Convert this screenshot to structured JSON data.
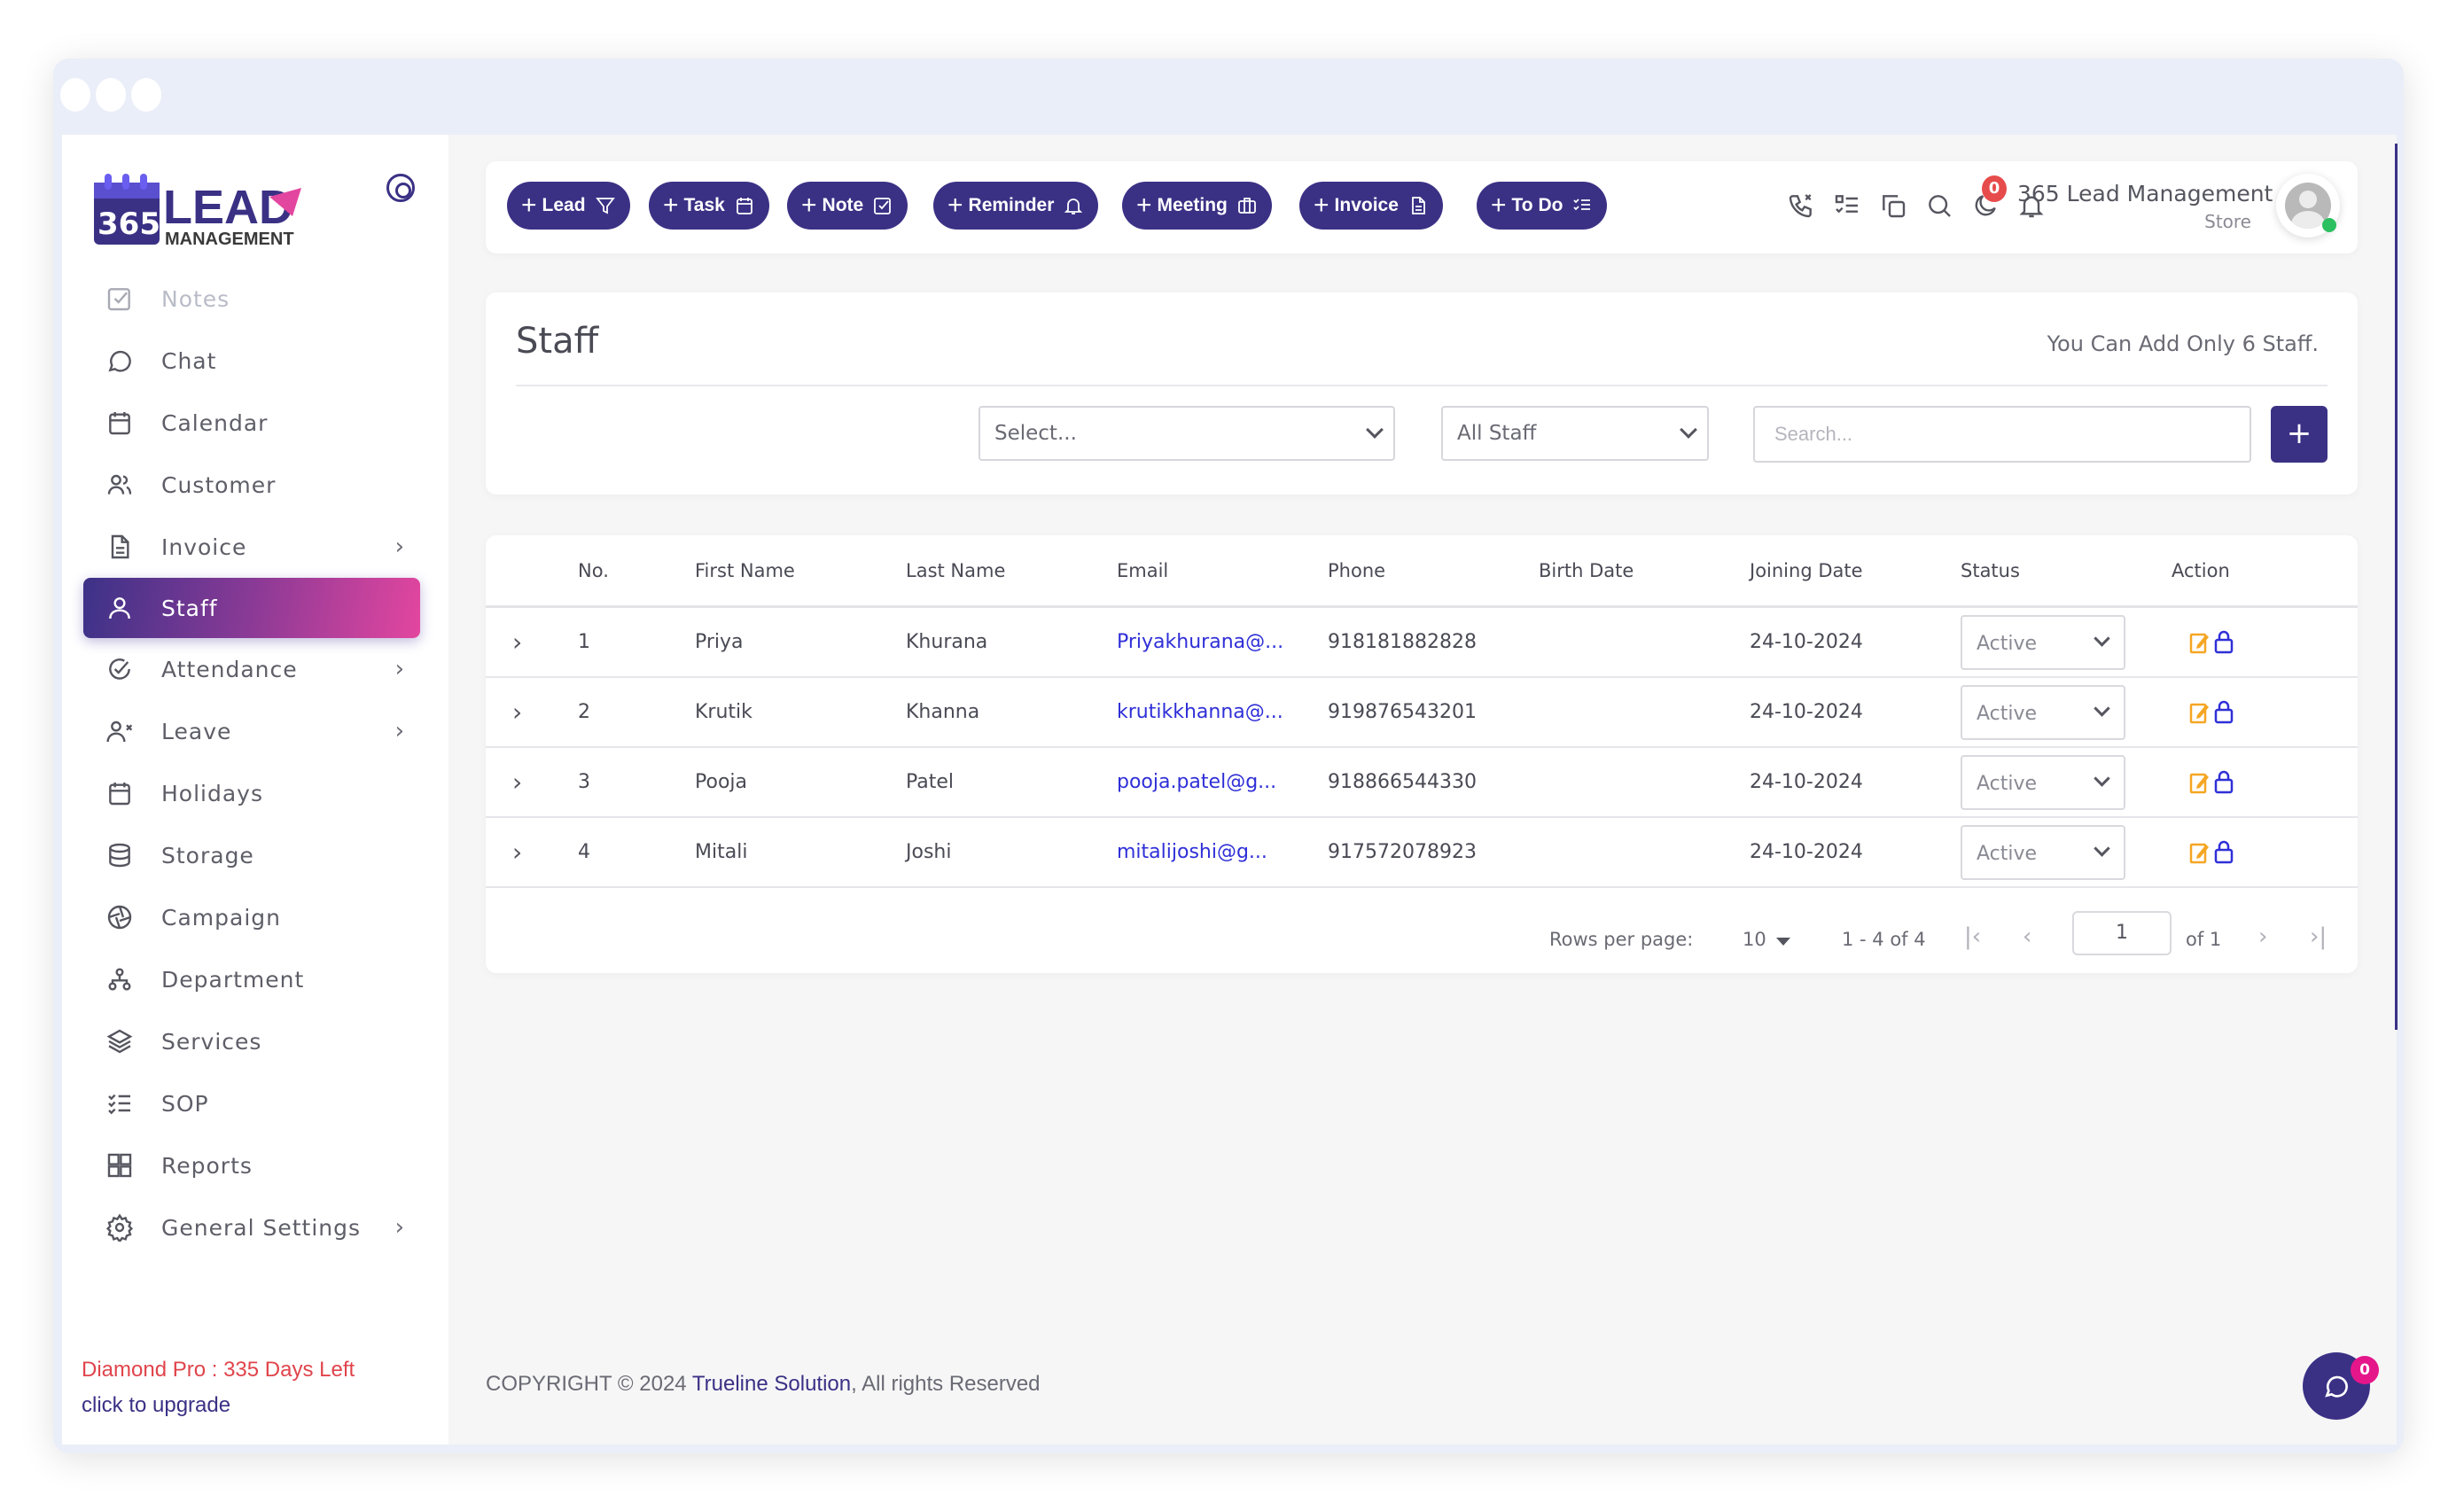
{
  "window": {
    "controls": [
      "close",
      "minimize",
      "maximize"
    ]
  },
  "brand": {
    "logo_number": "365",
    "logo_word": "LEAD",
    "logo_sub": "MANAGEMENT"
  },
  "sidebar": {
    "items": [
      {
        "label": "Notes",
        "icon": "check-square-icon",
        "state": "faded"
      },
      {
        "label": "Chat",
        "icon": "chat-icon"
      },
      {
        "label": "Calendar",
        "icon": "calendar-icon"
      },
      {
        "label": "Customer",
        "icon": "users-icon"
      },
      {
        "label": "Invoice",
        "icon": "file-icon",
        "has_submenu": true
      },
      {
        "label": "Staff",
        "icon": "user-icon",
        "state": "active"
      },
      {
        "label": "Attendance",
        "icon": "check-circle-icon",
        "has_submenu": true
      },
      {
        "label": "Leave",
        "icon": "user-x-icon",
        "has_submenu": true
      },
      {
        "label": "Holidays",
        "icon": "calendar-icon"
      },
      {
        "label": "Storage",
        "icon": "database-icon"
      },
      {
        "label": "Campaign",
        "icon": "aperture-icon"
      },
      {
        "label": "Department",
        "icon": "hierarchy-icon"
      },
      {
        "label": "Services",
        "icon": "layers-icon"
      },
      {
        "label": "SOP",
        "icon": "checklist-icon"
      },
      {
        "label": "Reports",
        "icon": "grid-icon"
      },
      {
        "label": "General Settings",
        "icon": "gear-icon",
        "has_submenu": true
      }
    ],
    "chevron": "›",
    "plan_text": "Diamond Pro : 335 Days Left",
    "upgrade_text": "click to upgrade"
  },
  "toolbar": {
    "quick_actions": [
      {
        "label": "Lead",
        "icon": "filter-icon"
      },
      {
        "label": "Task",
        "icon": "calendar-icon"
      },
      {
        "label": "Note",
        "icon": "check-square-icon"
      },
      {
        "label": "Reminder",
        "icon": "bell-icon"
      },
      {
        "label": "Meeting",
        "icon": "briefcase-icon"
      },
      {
        "label": "Invoice",
        "icon": "file-icon"
      },
      {
        "label": "To Do",
        "icon": "checklist-icon"
      }
    ],
    "plus": "+",
    "notification_count": "0",
    "user_name": "365 Lead Management",
    "user_role": "Store"
  },
  "staff": {
    "title": "Staff",
    "limit_text": "You Can Add Only 6 Staff.",
    "filter_select": "Select...",
    "staff_filter": "All Staff",
    "search_placeholder": "Search...",
    "add_label": "+"
  },
  "table": {
    "columns": [
      "No.",
      "First Name",
      "Last Name",
      "Email",
      "Phone",
      "Birth Date",
      "Joining Date",
      "Status",
      "Action"
    ],
    "rows": [
      {
        "no": "1",
        "first": "Priya",
        "last": "Khurana",
        "email": "Priyakhurana@...",
        "phone": "918181882828",
        "birth": "",
        "joining": "24-10-2024",
        "status": "Active"
      },
      {
        "no": "2",
        "first": "Krutik",
        "last": "Khanna",
        "email": "krutikkhanna@...",
        "phone": "919876543201",
        "birth": "",
        "joining": "24-10-2024",
        "status": "Active"
      },
      {
        "no": "3",
        "first": "Pooja",
        "last": "Patel",
        "email": "pooja.patel@g...",
        "phone": "918866544330",
        "birth": "",
        "joining": "24-10-2024",
        "status": "Active"
      },
      {
        "no": "4",
        "first": "Mitali",
        "last": "Joshi",
        "email": "mitalijoshi@g...",
        "phone": "917572078923",
        "birth": "",
        "joining": "24-10-2024",
        "status": "Active"
      }
    ],
    "expand_glyph": "›",
    "pagination": {
      "rows_per_page_label": "Rows per page:",
      "rows_per_page": "10",
      "range": "1 - 4 of 4",
      "current_page": "1",
      "of_pages": "of 1",
      "first": "|‹",
      "prev": "‹",
      "next": "›",
      "last": "›|"
    }
  },
  "footer": {
    "prefix": "COPYRIGHT © 2024 ",
    "company": "Trueline Solution",
    "suffix": ", All rights Reserved"
  },
  "chat_widget": {
    "count": "0"
  },
  "colors": {
    "brand": "#3a3185",
    "accent_pink": "#e3469f",
    "link": "#2f2fd8",
    "danger": "#e0444b",
    "edit": "#f5a623",
    "online": "#2bbf5f"
  }
}
